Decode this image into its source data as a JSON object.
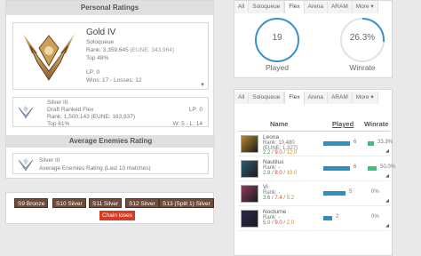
{
  "left": {
    "title": "Personal Ratings",
    "main": {
      "tier": "Gold IV",
      "queue": "Soloqueue",
      "rank": "Rank: 3,359,645",
      "rank_region": "(EUNE: 343,964)",
      "top": "Top 48%",
      "lp": "LP: 0",
      "record": "Wins: 17 - Losses: 12"
    },
    "flex": {
      "tier": "Silver III",
      "queue": "Draft Ranked Flex",
      "rank": "Rank: 1,500,143 (EUNE: 163,937)",
      "top": "Top 61%",
      "lp": "LP: 0",
      "record": "W: 5 - L: 14"
    },
    "enemies_title": "Average Enemies Rating",
    "enemies": {
      "tier": "Silver III",
      "desc": "Average Enemies Rating (Last 10 matches)"
    }
  },
  "seasons": {
    "badges": [
      "S9 Bronze",
      "S10 Silver",
      "S11 Silver",
      "S12 Silver",
      "S13 (Split 1) Silver"
    ],
    "chain": "Chain loses"
  },
  "stats_tabs": [
    "All",
    "Soloqueue",
    "Flex",
    "Arena",
    "ARAM",
    "More"
  ],
  "stats": {
    "played": "19",
    "played_label": "Played",
    "winrate": "26.3%",
    "winrate_label": "Winrate",
    "winrate_fraction": 0.263
  },
  "champ_tabs": [
    "All",
    "Soloqueue",
    "Flex",
    "Arena",
    "ARAM",
    "More"
  ],
  "champ_headers": {
    "name": "Name",
    "played": "Played",
    "winrate": "Winrate"
  },
  "champions": [
    {
      "name": "Leona",
      "rank": "Rank: 10,480",
      "rank2": "(EUNE: 1,327)",
      "k": "2.2",
      "d": "9.0",
      "a": "12.0",
      "played": "6",
      "played_frac": 1.0,
      "winrate": "33.3%",
      "win_frac": 0.333
    },
    {
      "name": "Nautilus",
      "rank": "Rank: -",
      "rank2": "",
      "k": "2.8",
      "d": "8.0",
      "a": "10.0",
      "played": "6",
      "played_frac": 1.0,
      "winrate": "50.0%",
      "win_frac": 0.5
    },
    {
      "name": "Vi",
      "rank": "Rank: -",
      "rank2": "",
      "k": "3.6",
      "d": "7.4",
      "a": "5.2",
      "played": "5",
      "played_frac": 0.83,
      "winrate": "0%",
      "win_frac": 0
    },
    {
      "name": "Nocturne",
      "rank": "Rank: -",
      "rank2": "",
      "k": "5.0",
      "d": "9.0",
      "a": "2.0",
      "played": "2",
      "played_frac": 0.33,
      "winrate": "0%",
      "win_frac": 0
    }
  ],
  "colors": {
    "played_bar": "#2f8fbe",
    "win_bar": "#3cc07f",
    "ring": "#3a8fc7",
    "season_badge": "#6e4b3a",
    "chain": "#d93a22"
  }
}
